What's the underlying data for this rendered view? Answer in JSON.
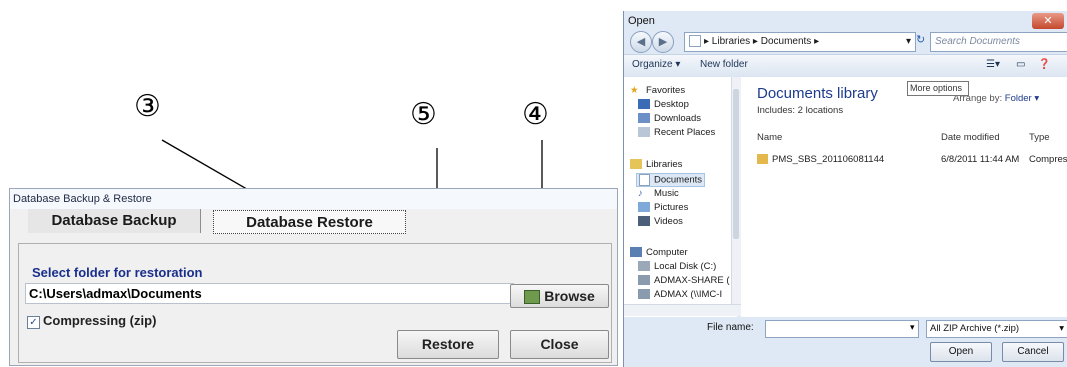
{
  "annotations": {
    "step3": "③",
    "step4": "④",
    "step5": "⑤"
  },
  "backup_dialog": {
    "title": "Database Backup & Restore",
    "tab_backup": "Database Backup",
    "tab_restore": "Database Restore",
    "select_folder_label": "Select folder for restoration",
    "folder_path": "C:\\Users\\admax\\Documents",
    "browse_label": "Browse",
    "compress_checked": true,
    "compress_label": "Compressing (zip)",
    "restore_label": "Restore",
    "close_label": "Close"
  },
  "open_dialog": {
    "title": "Open",
    "breadcrumb": "▸ Libraries ▸ Documents ▸",
    "search_placeholder": "Search Documents",
    "organize": "Organize ▾",
    "new_folder": "New folder",
    "tooltip": "More options",
    "favorites_header": "Favorites",
    "nav_favorites": [
      "Desktop",
      "Downloads",
      "Recent Places"
    ],
    "libraries_header": "Libraries",
    "nav_libraries": [
      "Documents",
      "Music",
      "Pictures",
      "Videos"
    ],
    "computer_header": "Computer",
    "nav_computer": [
      "Local Disk (C:)",
      "ADMAX-SHARE (",
      "ADMAX (\\\\IMC-I"
    ],
    "library_title": "Documents library",
    "includes": "Includes: 2 locations",
    "arrange_by": "Arrange by:",
    "arrange_value": "Folder ▾",
    "columns": [
      "Name",
      "Date modified",
      "Type"
    ],
    "file": {
      "name": "PMS_SBS_201106081144",
      "date": "6/8/2011 11:44 AM",
      "type": "Compresse"
    },
    "filename_label": "File name:",
    "filename_value": "",
    "filetype": "All ZIP Archive (*.zip)",
    "open_label": "Open",
    "cancel_label": "Cancel"
  },
  "colors": {
    "accent_blue": "#1e3b8c",
    "label_blue": "#1a2f8c"
  }
}
